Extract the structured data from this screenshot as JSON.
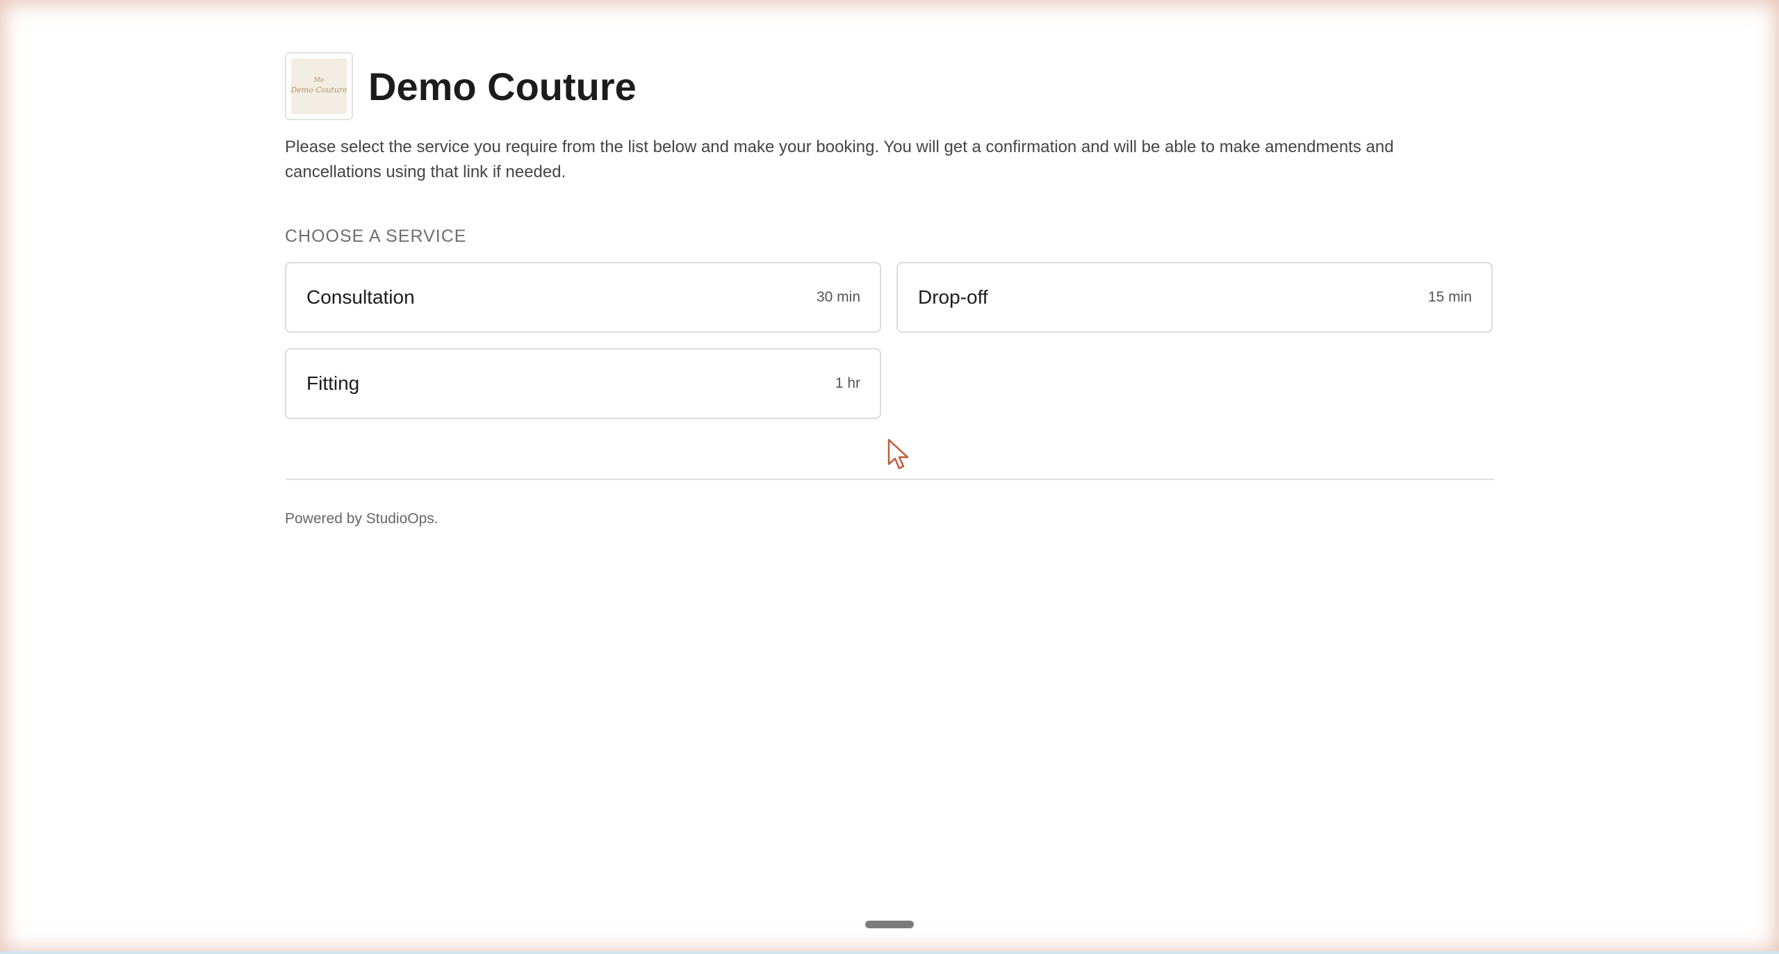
{
  "brand": {
    "name": "Demo Couture",
    "logo_mark": "Me",
    "logo_text": "Demo Couture"
  },
  "intro": "Please select the service you require from the list below and make your booking. You will get a confirmation and will be able to make amendments and cancellations using that link if needed.",
  "section_label": "CHOOSE A SERVICE",
  "services": [
    {
      "name": "Consultation",
      "duration": "30 min"
    },
    {
      "name": "Drop-off",
      "duration": "15 min"
    },
    {
      "name": "Fitting",
      "duration": "1 hr"
    }
  ],
  "footer": {
    "text": "Powered by StudioOps."
  },
  "colors": {
    "frame_glow": "#d6967d",
    "card_border": "#dcdcdc",
    "cursor_outline": "#c2583a"
  },
  "icons": {
    "cursor": "mouse-pointer-icon",
    "home_indicator": "home-indicator-bar"
  }
}
